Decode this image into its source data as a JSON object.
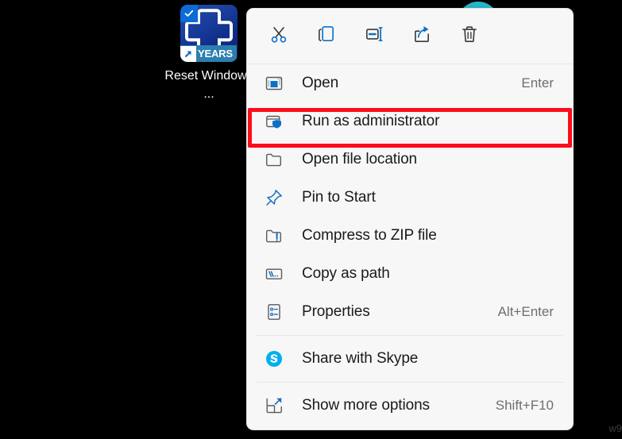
{
  "desktop": {
    "icon": {
      "label": "Reset Windows ...",
      "badge_text": "YEARS",
      "tile_color": "#163a96",
      "badge_color": "#2c7fae",
      "selected": true
    }
  },
  "accent": {
    "blue": "#0a71c8",
    "red": "#fc0d1b",
    "teal": "#29bed2",
    "skype": "#00aff0"
  },
  "context_menu": {
    "toolbar": [
      {
        "name": "cut",
        "label": "Cut"
      },
      {
        "name": "copy",
        "label": "Copy"
      },
      {
        "name": "rename",
        "label": "Rename"
      },
      {
        "name": "share",
        "label": "Share"
      },
      {
        "name": "delete",
        "label": "Delete"
      }
    ],
    "items": [
      {
        "icon": "open-window-icon",
        "label": "Open",
        "shortcut": "Enter",
        "highlighted": false
      },
      {
        "icon": "shield-window-icon",
        "label": "Run as administrator",
        "shortcut": "",
        "highlighted": true
      },
      {
        "icon": "folder-icon",
        "label": "Open file location",
        "shortcut": "",
        "highlighted": false
      },
      {
        "icon": "pin-icon",
        "label": "Pin to Start",
        "shortcut": "",
        "highlighted": false
      },
      {
        "icon": "zip-folder-icon",
        "label": "Compress to ZIP file",
        "shortcut": "",
        "highlighted": false
      },
      {
        "icon": "copy-path-icon",
        "label": "Copy as path",
        "shortcut": "",
        "highlighted": false
      },
      {
        "icon": "properties-icon",
        "label": "Properties",
        "shortcut": "Alt+Enter",
        "highlighted": false
      },
      {
        "icon": "skype-icon",
        "label": "Share with Skype",
        "shortcut": "",
        "highlighted": false
      },
      {
        "icon": "expand-arrow-icon",
        "label": "Show more options",
        "shortcut": "Shift+F10",
        "highlighted": false
      }
    ]
  },
  "watermark": {
    "text": "w9"
  }
}
